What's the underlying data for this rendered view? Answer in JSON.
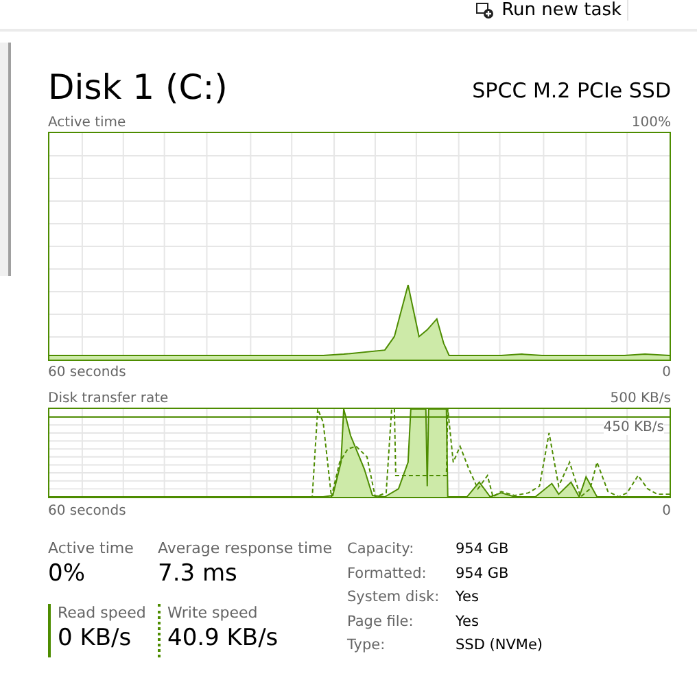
{
  "toolbar": {
    "run_task": "Run new task"
  },
  "disk": {
    "title": "Disk 1 (C:)",
    "model": "SPCC M.2 PCIe SSD"
  },
  "active_chart": {
    "label": "Active time",
    "max": "100%",
    "x_label": "60 seconds",
    "min": "0"
  },
  "transfer_chart": {
    "label": "Disk transfer rate",
    "max": "500 KB/s",
    "marker": "450 KB/s",
    "x_label": "60 seconds",
    "min": "0"
  },
  "stats": [
    {
      "label": "Active time",
      "value": "0%",
      "kind": "plain"
    },
    {
      "label": "Average response time",
      "value": "7.3 ms",
      "kind": "plain"
    },
    {
      "label": "Read speed",
      "value": "0 KB/s",
      "kind": "solid"
    },
    {
      "label": "Write speed",
      "value": "40.9 KB/s",
      "kind": "dotted"
    }
  ],
  "properties": [
    {
      "label": "Capacity:",
      "value": "954 GB"
    },
    {
      "label": "Formatted:",
      "value": "954 GB"
    },
    {
      "label": "System disk:",
      "value": "Yes"
    },
    {
      "label": "Page file:",
      "value": "Yes"
    },
    {
      "label": "Type:",
      "value": "SSD (NVMe)"
    }
  ]
}
